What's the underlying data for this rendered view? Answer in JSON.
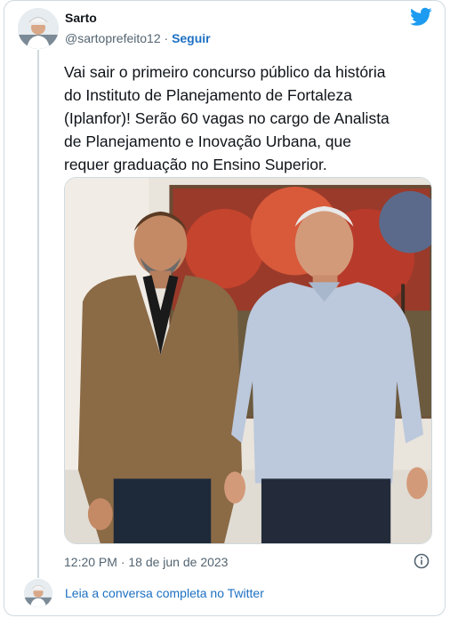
{
  "author": {
    "name": "Sarto",
    "handle": "@sartoprefeito12",
    "separator": "·",
    "follow_label": "Seguir"
  },
  "tweet": {
    "text": "Vai sair o primeiro concurso público da história\ndo Instituto de Planejamento de Fortaleza\n(Iplanfor)! Serão 60 vagas no cargo de Analista\nde Planejamento e Inovação Urbana, que\nrequer graduação no Ensino Superior.",
    "timestamp": "12:20 PM · 18 de jun de 2023"
  },
  "footer": {
    "read_more": "Leia a conversa completa no Twitter"
  },
  "icons": {
    "brand": "twitter-bird-icon",
    "info": "info-icon"
  },
  "colors": {
    "brand_blue": "#1d9bf0",
    "link_blue": "#1d70c2",
    "secondary_text": "#536471",
    "border": "#cfd9de"
  }
}
